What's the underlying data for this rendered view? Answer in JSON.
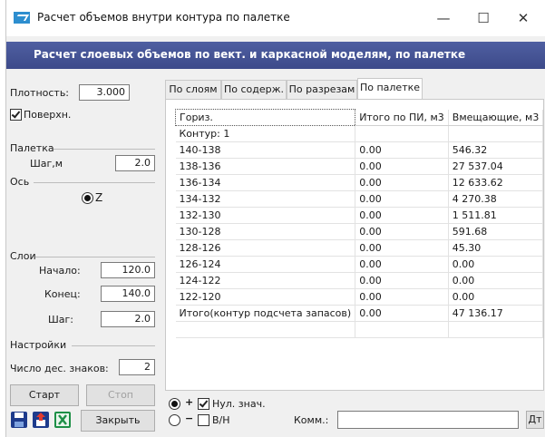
{
  "window": {
    "title": "Расчет объемов внутри контура по палетке",
    "minimize": "—",
    "maximize": "☐",
    "close": "✕"
  },
  "header": {
    "text": "Расчет слоевых объемов по вект. и каркасной моделям, по палетке"
  },
  "left": {
    "density_label": "Плотность:",
    "density_value": "3.000",
    "surface_label": "Поверхн.",
    "palette_group": "Палетка",
    "step_label": "Шаг,м",
    "step_value": "2.0",
    "axis_group": "Ось",
    "axis_option": "Z",
    "layers_group": "Слои",
    "start_label": "Начало:",
    "start_value": "120.0",
    "end_label": "Конец:",
    "end_value": "140.0",
    "layer_step_label": "Шаг:",
    "layer_step_value": "2.0",
    "settings_group": "Настройки",
    "decimals_label": "Число дес. знаков:",
    "decimals_value": "2",
    "start_button": "Старт",
    "stop_button": "Стоп",
    "close_button": "Закрыть"
  },
  "tabs": [
    "По слоям",
    "По содерж.",
    "По разрезам",
    "По палетке"
  ],
  "table": {
    "headers": [
      "Гориз.",
      "Итого по ПИ, м3",
      "Вмещающие, м3"
    ],
    "rows": [
      [
        "Контур: 1",
        "",
        ""
      ],
      [
        "140-138",
        "0.00",
        "546.32"
      ],
      [
        "138-136",
        "0.00",
        "27 537.04"
      ],
      [
        "136-134",
        "0.00",
        "12 633.62"
      ],
      [
        "134-132",
        "0.00",
        "4 270.38"
      ],
      [
        "132-130",
        "0.00",
        "1 511.81"
      ],
      [
        "130-128",
        "0.00",
        "591.68"
      ],
      [
        "128-126",
        "0.00",
        "45.30"
      ],
      [
        "126-124",
        "0.00",
        "0.00"
      ],
      [
        "124-122",
        "0.00",
        "0.00"
      ],
      [
        "122-120",
        "0.00",
        "0.00"
      ],
      [
        "Итого(контур подсчета запасов)",
        "0.00",
        "47 136.17"
      ],
      [
        "",
        "",
        ""
      ]
    ]
  },
  "bottom": {
    "plus": "+",
    "minus": "−",
    "null_values_label": "Нул. знач.",
    "bn_label": "В/Н",
    "comment_label": "Комм.:",
    "comment_value": "",
    "dt_button": "Дт"
  }
}
